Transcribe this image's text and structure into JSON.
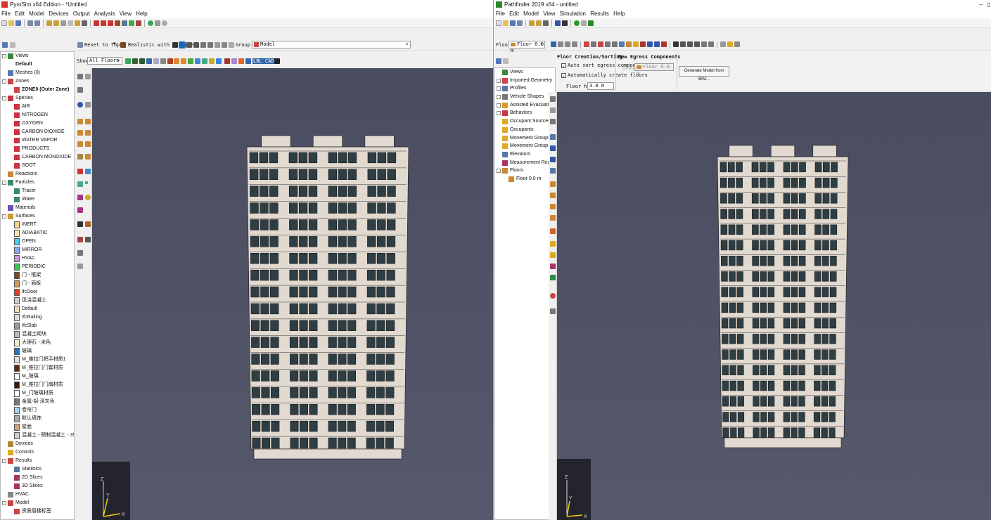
{
  "pyro": {
    "title": "PyroSim x64 Edition - *Untitled",
    "menu": [
      "File",
      "Edit",
      "Model",
      "Devices",
      "Output",
      "Analysis",
      "View",
      "Help"
    ],
    "bar2": {
      "reset_label": "Reset to Top",
      "render_label": "Realistic with Outlines",
      "group_label": "Group:",
      "group_value": "Model",
      "show_label": "Show:",
      "show_value": "All Floors",
      "lbl_cad": "LBL CAD"
    },
    "tree": [
      {
        "label": "Views",
        "indent": 0,
        "exp": true,
        "icon": "#3a8a3a"
      },
      {
        "label": "Default",
        "indent": 1,
        "bold": true
      },
      {
        "label": "Meshes (0)",
        "indent": 0,
        "icon": "#5577aa"
      },
      {
        "label": "Zones",
        "indent": 0,
        "exp": true,
        "icon": "#cc4444"
      },
      {
        "label": "ZONE0 (Outer Zone)",
        "indent": 1,
        "bold": true,
        "icon": "#cc4444"
      },
      {
        "label": "Species",
        "indent": 0,
        "exp": true,
        "icon": "#cc3344"
      },
      {
        "label": "AIR",
        "indent": 1,
        "icon": "#cc3344"
      },
      {
        "label": "NITROGEN",
        "indent": 1,
        "icon": "#cc3344"
      },
      {
        "label": "OXYGEN",
        "indent": 1,
        "icon": "#cc3344"
      },
      {
        "label": "CARBON DIOXIDE",
        "indent": 1,
        "icon": "#cc3344"
      },
      {
        "label": "WATER VAPOR",
        "indent": 1,
        "icon": "#cc3344"
      },
      {
        "label": "PRODUCTS",
        "indent": 1,
        "icon": "#cc3344"
      },
      {
        "label": "CARBON MONOXIDE",
        "indent": 1,
        "icon": "#cc3344"
      },
      {
        "label": "SOOT",
        "indent": 1,
        "icon": "#cc3344"
      },
      {
        "label": "Reactions",
        "indent": 0,
        "icon": "#cc8833"
      },
      {
        "label": "Particles",
        "indent": 0,
        "exp": true,
        "icon": "#3a8a6a"
      },
      {
        "label": "Tracer",
        "indent": 1,
        "icon": "#3a8a6a"
      },
      {
        "label": "Water",
        "indent": 1,
        "icon": "#3a8a6a"
      },
      {
        "label": "Materials",
        "indent": 0,
        "icon": "#6655aa"
      },
      {
        "label": "Surfaces",
        "indent": 0,
        "exp": true,
        "icon": "#cc9933"
      },
      {
        "label": "INERT",
        "indent": 1,
        "swatch": "#f7d58a"
      },
      {
        "label": "ADIABATIC",
        "indent": 1,
        "swatch": "#f7e9b0"
      },
      {
        "label": "OPEN",
        "indent": 1,
        "swatch": "#44ccee"
      },
      {
        "label": "MIRROR",
        "indent": 1,
        "swatch": "#88aaee"
      },
      {
        "label": "HVAC",
        "indent": 1,
        "swatch": "#cc99dd"
      },
      {
        "label": "PERIODIC",
        "indent": 1,
        "swatch": "#33cc55"
      },
      {
        "label": "门 - 框架",
        "indent": 1,
        "swatch": "#7a4a22"
      },
      {
        "label": "门 - 面板",
        "indent": 1,
        "swatch": "#d19a55"
      },
      {
        "label": "ifcDoor",
        "indent": 1,
        "swatch": "#dd4422"
      },
      {
        "label": "现浇混凝土",
        "indent": 1,
        "swatch": "#cccccc"
      },
      {
        "label": "Default",
        "indent": 1,
        "swatch": "#e8d8b8"
      },
      {
        "label": "IfcRailing",
        "indent": 1,
        "swatch": "#dddddd"
      },
      {
        "label": "IfcSlab",
        "indent": 1,
        "swatch": "#999999"
      },
      {
        "label": "混凝土砌块",
        "indent": 1,
        "swatch": "#bbbbbb"
      },
      {
        "label": "大理石 - 米色",
        "indent": 1,
        "swatch": "#f2ead5"
      },
      {
        "label": "玻璃",
        "indent": 1,
        "swatch": "#2277bb"
      },
      {
        "label": "M_推拉门把手材质1",
        "indent": 1,
        "swatch": "#e0e0e0"
      },
      {
        "label": "M_推拉门门套材质",
        "indent": 1,
        "swatch": "#5a2a14"
      },
      {
        "label": "M_玻璃",
        "indent": 1,
        "swatch": "#ffffff"
      },
      {
        "label": "M_推拉门门扇材质",
        "indent": 1,
        "swatch": "#3a1a0a"
      },
      {
        "label": "M_门玻璃材质",
        "indent": 1,
        "swatch": "#ffffff"
      },
      {
        "label": "金属-铝-深灰色",
        "indent": 1,
        "swatch": "#777777"
      },
      {
        "label": "卷帘门",
        "indent": 1,
        "swatch": "#aad4ee"
      },
      {
        "label": "默认墙饰",
        "indent": 1,
        "swatch": "#aaaaaa"
      },
      {
        "label": "屋面",
        "indent": 1,
        "swatch": "#c9a57a"
      },
      {
        "label": "混凝土 - 预制混凝土 - 35 MPa",
        "indent": 1,
        "swatch": "#cdcdcd"
      },
      {
        "label": "Devices",
        "indent": 0,
        "icon": "#aa8833"
      },
      {
        "label": "Controls",
        "indent": 0,
        "icon": "#ddaa22"
      },
      {
        "label": "Results",
        "indent": 0,
        "exp": true,
        "icon": "#cc4444"
      },
      {
        "label": "Statistics",
        "indent": 1,
        "icon": "#557799"
      },
      {
        "label": "2D Slices",
        "indent": 1,
        "icon": "#aa3366"
      },
      {
        "label": "3D Slices",
        "indent": 1,
        "icon": "#aa3366"
      },
      {
        "label": "HVAC",
        "indent": 0,
        "icon": "#888888"
      },
      {
        "label": "Model",
        "indent": 0,
        "exp": true,
        "icon": "#cc4444"
      },
      {
        "label": "资质层楼标签",
        "indent": 1,
        "icon": "#cc4444"
      }
    ]
  },
  "path": {
    "title": "Pathfinder 2019 x64 - untitled",
    "menu": [
      "File",
      "Edit",
      "Model",
      "View",
      "Simulation",
      "Results",
      "Help"
    ],
    "floor_label": "Floor:",
    "floor_value": "Floor 0.0 m",
    "floor_panel": {
      "section1_title": "Floor Creation/Sorting",
      "opt1": "Auto sort egress components",
      "opt2": "Automatically create floors",
      "height_label": "Floor height:",
      "height_value": "3.0 m",
      "section2_title": "New Egress Components",
      "group_label": "Group:",
      "group_value": "Floor 0.0 m",
      "generate_label": "Generate Model from BIM..."
    },
    "tree": [
      {
        "label": "Views",
        "indent": 0,
        "icon": "#3a8a3a"
      },
      {
        "label": "Imported Geometry",
        "indent": 0,
        "exp": true,
        "icon": "#cc4444"
      },
      {
        "label": "Profiles",
        "indent": 0,
        "exp": true,
        "icon": "#5577aa"
      },
      {
        "label": "Vehicle Shapes",
        "indent": 0,
        "exp": true,
        "icon": "#777777"
      },
      {
        "label": "Assisted Evacuation Teams",
        "indent": 0,
        "exp": true,
        "icon": "#dd9922"
      },
      {
        "label": "Behaviors",
        "indent": 0,
        "exp": true,
        "icon": "#cc3344"
      },
      {
        "label": "Occupant Sources",
        "indent": 0,
        "icon": "#ddaa22"
      },
      {
        "label": "Occupants",
        "indent": 0,
        "icon": "#ddaa22"
      },
      {
        "label": "Movement Groups",
        "indent": 0,
        "icon": "#ddaa22"
      },
      {
        "label": "Movement Group Templates",
        "indent": 0,
        "icon": "#ddaa22"
      },
      {
        "label": "Elevators",
        "indent": 0,
        "icon": "#5577aa"
      },
      {
        "label": "Measurement Regions",
        "indent": 0,
        "icon": "#aa3366"
      },
      {
        "label": "Floors",
        "indent": 0,
        "exp": true,
        "icon": "#cc8833"
      },
      {
        "label": "Floor 0.0 m",
        "indent": 1,
        "icon": "#cc8833"
      }
    ]
  },
  "colors": {
    "viewport": "#4e5064",
    "facade": "#e2dad0",
    "window": "#2e3e44",
    "window_frame": "#1a1a1a",
    "highlight": "#c6d8ee"
  }
}
